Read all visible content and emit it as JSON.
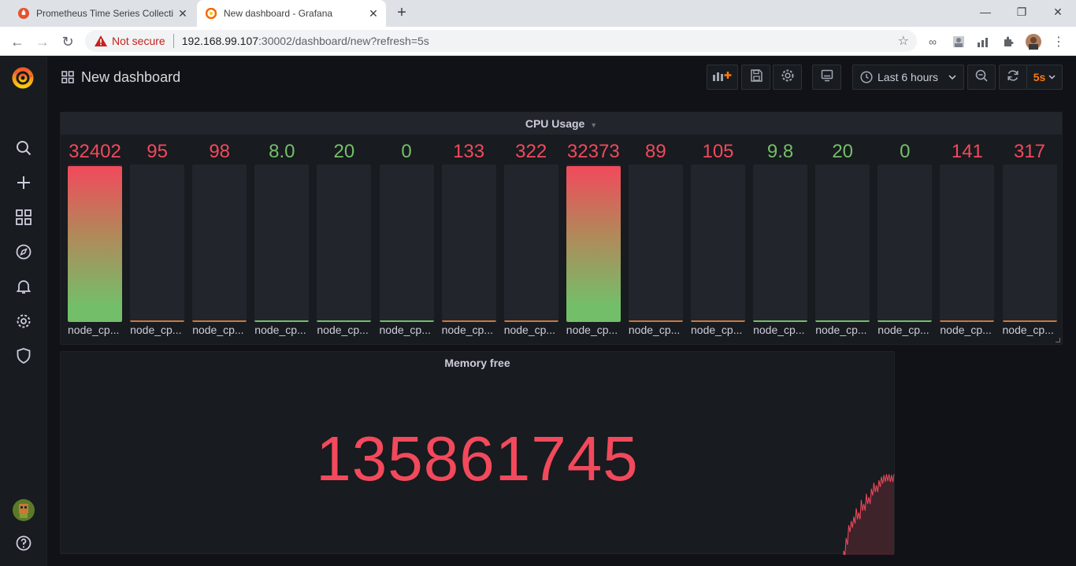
{
  "browser": {
    "tabs": [
      {
        "title": "Prometheus Time Series Collection",
        "favicon": "prometheus-icon"
      },
      {
        "title": "New dashboard - Grafana",
        "favicon": "grafana-icon"
      }
    ],
    "security_label": "Not secure",
    "url_host": "192.168.99.107",
    "url_rest": ":30002/dashboard/new?refresh=5s"
  },
  "dashboard": {
    "title": "New dashboard",
    "time_range": "Last 6 hours",
    "refresh": "5s"
  },
  "cpu_panel": {
    "title": "CPU Usage",
    "gauges": [
      {
        "value": "32402",
        "level": 1.0,
        "color": "red",
        "label": "node_cp..."
      },
      {
        "value": "95",
        "level": 0.003,
        "color": "red",
        "label": "node_cp..."
      },
      {
        "value": "98",
        "level": 0.003,
        "color": "red",
        "label": "node_cp..."
      },
      {
        "value": "8.0",
        "level": 0.0002,
        "color": "green",
        "label": "node_cp..."
      },
      {
        "value": "20",
        "level": 0.0006,
        "color": "green",
        "label": "node_cp..."
      },
      {
        "value": "0",
        "level": 0.0,
        "color": "green",
        "label": "node_cp..."
      },
      {
        "value": "133",
        "level": 0.004,
        "color": "red",
        "label": "node_cp..."
      },
      {
        "value": "322",
        "level": 0.01,
        "color": "red",
        "label": "node_cp..."
      },
      {
        "value": "32373",
        "level": 1.0,
        "color": "red",
        "label": "node_cp..."
      },
      {
        "value": "89",
        "level": 0.003,
        "color": "red",
        "label": "node_cp..."
      },
      {
        "value": "105",
        "level": 0.003,
        "color": "red",
        "label": "node_cp..."
      },
      {
        "value": "9.8",
        "level": 0.0003,
        "color": "green",
        "label": "node_cp..."
      },
      {
        "value": "20",
        "level": 0.0006,
        "color": "green",
        "label": "node_cp..."
      },
      {
        "value": "0",
        "level": 0.0,
        "color": "green",
        "label": "node_cp..."
      },
      {
        "value": "141",
        "level": 0.004,
        "color": "red",
        "label": "node_cp..."
      },
      {
        "value": "317",
        "level": 0.01,
        "color": "red",
        "label": "node_cp..."
      }
    ]
  },
  "memory_panel": {
    "title": "Memory free",
    "value": "135861745",
    "sparkline": [
      0.05,
      0.2,
      0.35,
      0.4,
      0.45,
      0.55,
      0.5,
      0.65,
      0.6,
      0.72,
      0.68,
      0.78,
      0.85,
      0.82,
      0.88,
      0.92,
      0.94,
      0.95,
      0.95,
      0.94,
      0.95
    ]
  },
  "colors": {
    "red": "#f2495c",
    "green": "#73bf69",
    "orange": "#ff780a"
  }
}
